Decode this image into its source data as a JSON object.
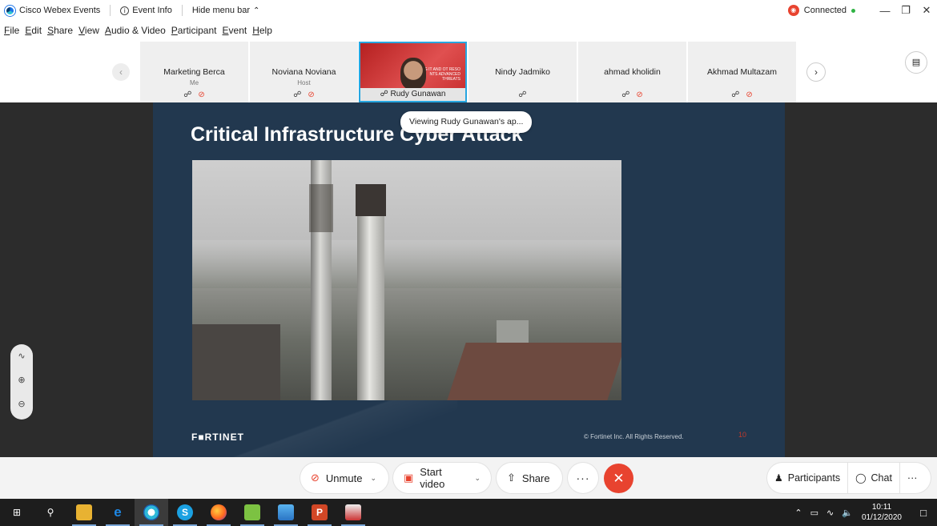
{
  "titlebar": {
    "app_name": "Cisco Webex Events",
    "event_info": "Event Info",
    "hide_menu": "Hide menu bar",
    "status": "Connected"
  },
  "menu": [
    "File",
    "Edit",
    "Share",
    "View",
    "Audio & Video",
    "Participant",
    "Event",
    "Help"
  ],
  "participants": [
    {
      "name": "Marketing Berca",
      "role": "Me",
      "muted": true
    },
    {
      "name": "Noviana Noviana",
      "role": "Host",
      "muted": true
    },
    {
      "name": "Rudy Gunawan",
      "role": "",
      "muted": false,
      "presenting": true,
      "mini_slide_text": "CTING IT AND OT RESO NTS ADVANCED THREATS"
    },
    {
      "name": "Nindy Jadmiko",
      "role": "",
      "muted": false
    },
    {
      "name": "ahmad kholidin",
      "role": "",
      "muted": true
    },
    {
      "name": "Akhmad Multazam",
      "role": "",
      "muted": true
    }
  ],
  "tooltip": "Viewing Rudy Gunawan's ap...",
  "slide": {
    "title": "Critical Infrastructure Cyber Attack",
    "logo": "F■RTINET",
    "copyright": "© Fortinet Inc. All Rights Reserved.",
    "page": "10"
  },
  "controls": {
    "unmute": "Unmute",
    "start_video": "Start video",
    "share": "Share",
    "more": "···",
    "end": "✕",
    "participants": "Participants",
    "chat": "Chat"
  },
  "taskbar": {
    "time": "10:11",
    "date": "01/12/2020"
  },
  "colors": {
    "accent_red": "#e8432f",
    "slide_bg": "#22384f",
    "connected_green": "#2fb344",
    "active_border": "#27a6e0"
  }
}
